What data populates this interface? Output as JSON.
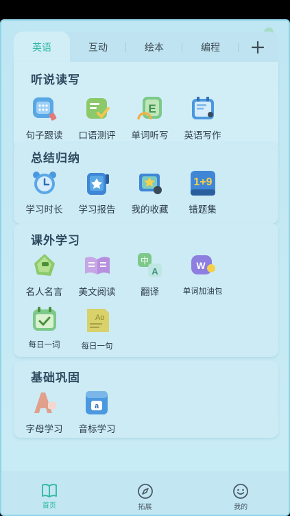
{
  "tabs": [
    {
      "label": "英语",
      "active": true
    },
    {
      "label": "互动",
      "active": false
    },
    {
      "label": "绘本",
      "active": false
    },
    {
      "label": "编程",
      "active": false
    }
  ],
  "add_icon": "plus-icon",
  "sections": [
    {
      "title": "听说读写",
      "items": [
        {
          "label": "句子跟读",
          "icon": "sentence-repeat-icon"
        },
        {
          "label": "口语测评",
          "icon": "speaking-evaluation-icon"
        },
        {
          "label": "单词听写",
          "icon": "word-dictation-icon"
        },
        {
          "label": "英语写作",
          "icon": "english-writing-icon"
        }
      ]
    },
    {
      "title": "总结归纳",
      "items": [
        {
          "label": "学习时长",
          "icon": "alarm-clock-icon"
        },
        {
          "label": "学习报告",
          "icon": "report-icon"
        },
        {
          "label": "我的收藏",
          "icon": "favorites-icon"
        },
        {
          "label": "错题集",
          "icon": "wrong-questions-icon"
        }
      ]
    },
    {
      "title": "课外学习",
      "items": [
        {
          "label": "名人名言",
          "icon": "quotes-icon"
        },
        {
          "label": "美文阅读",
          "icon": "reading-book-icon"
        },
        {
          "label": "翻译",
          "icon": "translate-icon"
        },
        {
          "label": "单词加油包",
          "icon": "word-boost-icon"
        },
        {
          "label": "每日一词",
          "icon": "daily-word-icon"
        },
        {
          "label": "每日一句",
          "icon": "daily-sentence-icon"
        }
      ]
    },
    {
      "title": "基础巩固",
      "items": [
        {
          "label": "字母学习",
          "icon": "alphabet-icon"
        },
        {
          "label": "音标学习",
          "icon": "phonetic-icon"
        }
      ]
    }
  ],
  "bottom_nav": [
    {
      "label": "首页",
      "icon": "book-icon",
      "active": true
    },
    {
      "label": "拓展",
      "icon": "compass-icon",
      "active": false
    },
    {
      "label": "我的",
      "icon": "smiley-icon",
      "active": false
    }
  ],
  "colors": {
    "accent": "#2db6a3",
    "background": "#c6eaf5",
    "card": "#cdebf5",
    "title_text": "#2f4a60"
  }
}
